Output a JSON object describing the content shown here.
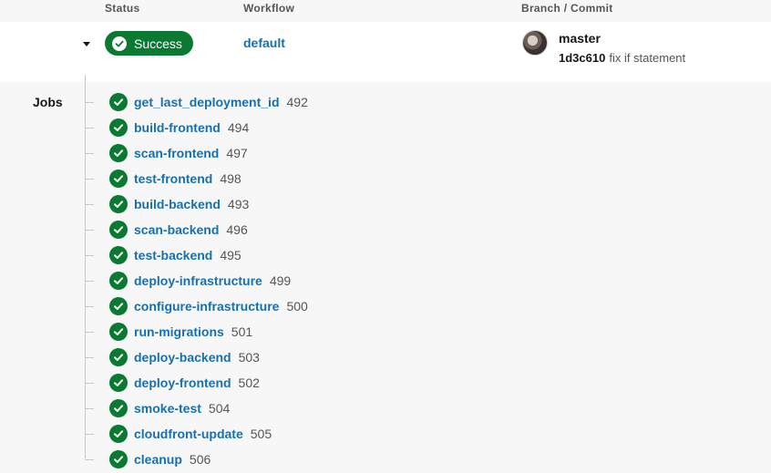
{
  "header": {
    "status": "Status",
    "workflow": "Workflow",
    "branch_commit": "Branch / Commit"
  },
  "pipeline": {
    "status": "Success",
    "workflow": "default",
    "branch": "master",
    "commit_hash": "1d3c610",
    "commit_message": "fix if statement"
  },
  "jobs_label": "Jobs",
  "jobs": [
    {
      "name": "get_last_deployment_id",
      "number": "492"
    },
    {
      "name": "build-frontend",
      "number": "494"
    },
    {
      "name": "scan-frontend",
      "number": "497"
    },
    {
      "name": "test-frontend",
      "number": "498"
    },
    {
      "name": "build-backend",
      "number": "493"
    },
    {
      "name": "scan-backend",
      "number": "496"
    },
    {
      "name": "test-backend",
      "number": "495"
    },
    {
      "name": "deploy-infrastructure",
      "number": "499"
    },
    {
      "name": "configure-infrastructure",
      "number": "500"
    },
    {
      "name": "run-migrations",
      "number": "501"
    },
    {
      "name": "deploy-backend",
      "number": "503"
    },
    {
      "name": "deploy-frontend",
      "number": "502"
    },
    {
      "name": "smoke-test",
      "number": "504"
    },
    {
      "name": "cloudfront-update",
      "number": "505"
    },
    {
      "name": "cleanup",
      "number": "506"
    }
  ],
  "icons": {
    "success": "check-circle-icon",
    "expand": "chevron-down-icon"
  },
  "colors": {
    "success": "#0a7a33",
    "link": "#1670b0"
  }
}
